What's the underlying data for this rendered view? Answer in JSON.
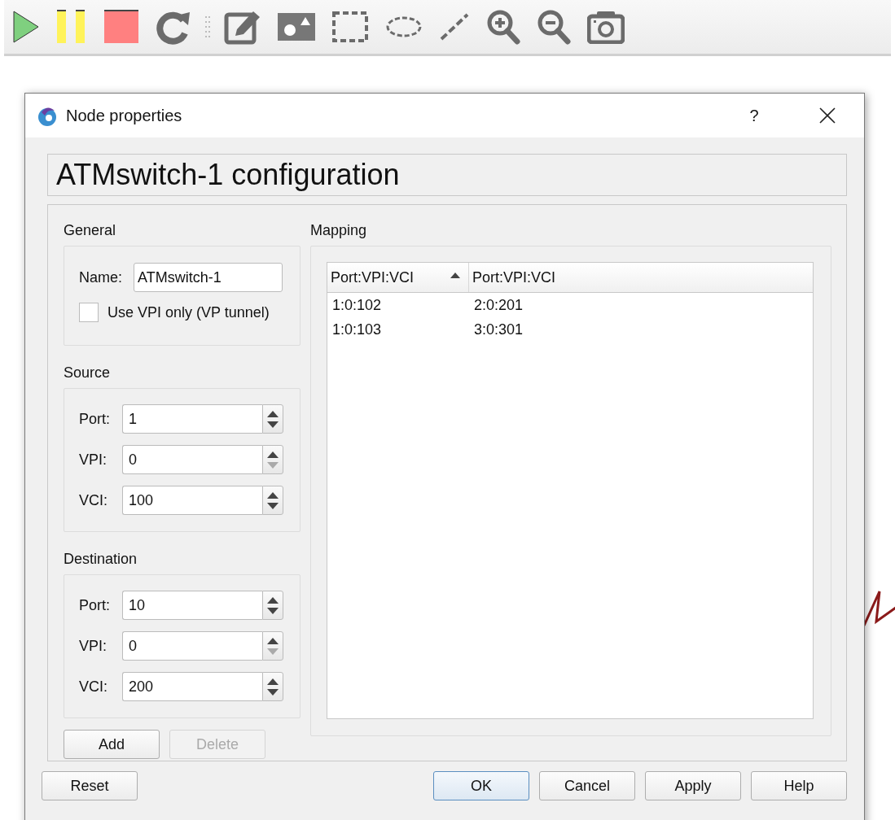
{
  "window": {
    "title": "Node properties",
    "help": "?"
  },
  "heading": "ATMswitch-1 configuration",
  "general": {
    "label": "General",
    "name_label": "Name:",
    "name_value": "ATMswitch-1",
    "vpi_only": {
      "label": "Use VPI only (VP tunnel)",
      "checked": false
    }
  },
  "source": {
    "label": "Source",
    "fields": [
      {
        "label": "Port:",
        "value": "1",
        "down_enabled": true
      },
      {
        "label": "VPI:",
        "value": "0",
        "down_enabled": false
      },
      {
        "label": "VCI:",
        "value": "100",
        "down_enabled": true
      }
    ]
  },
  "destination": {
    "label": "Destination",
    "fields": [
      {
        "label": "Port:",
        "value": "10",
        "down_enabled": true
      },
      {
        "label": "VPI:",
        "value": "0",
        "down_enabled": false
      },
      {
        "label": "VCI:",
        "value": "200",
        "down_enabled": true
      }
    ]
  },
  "actions": [
    {
      "label": "Add",
      "disabled": false
    },
    {
      "label": "Delete",
      "disabled": true
    }
  ],
  "mapping": {
    "label": "Mapping",
    "columns": [
      {
        "label": "Port:VPI:VCI",
        "sorted": true
      },
      {
        "label": "Port:VPI:VCI",
        "sorted": false
      }
    ],
    "rows": [
      [
        "1:0:102",
        "2:0:201"
      ],
      [
        "1:0:103",
        "3:0:301"
      ]
    ]
  },
  "buttons": [
    {
      "label": "Reset",
      "default": false
    },
    {
      "label": "OK",
      "default": true
    },
    {
      "label": "Cancel",
      "default": false
    },
    {
      "label": "Apply",
      "default": false
    },
    {
      "label": "Help",
      "default": false
    }
  ]
}
